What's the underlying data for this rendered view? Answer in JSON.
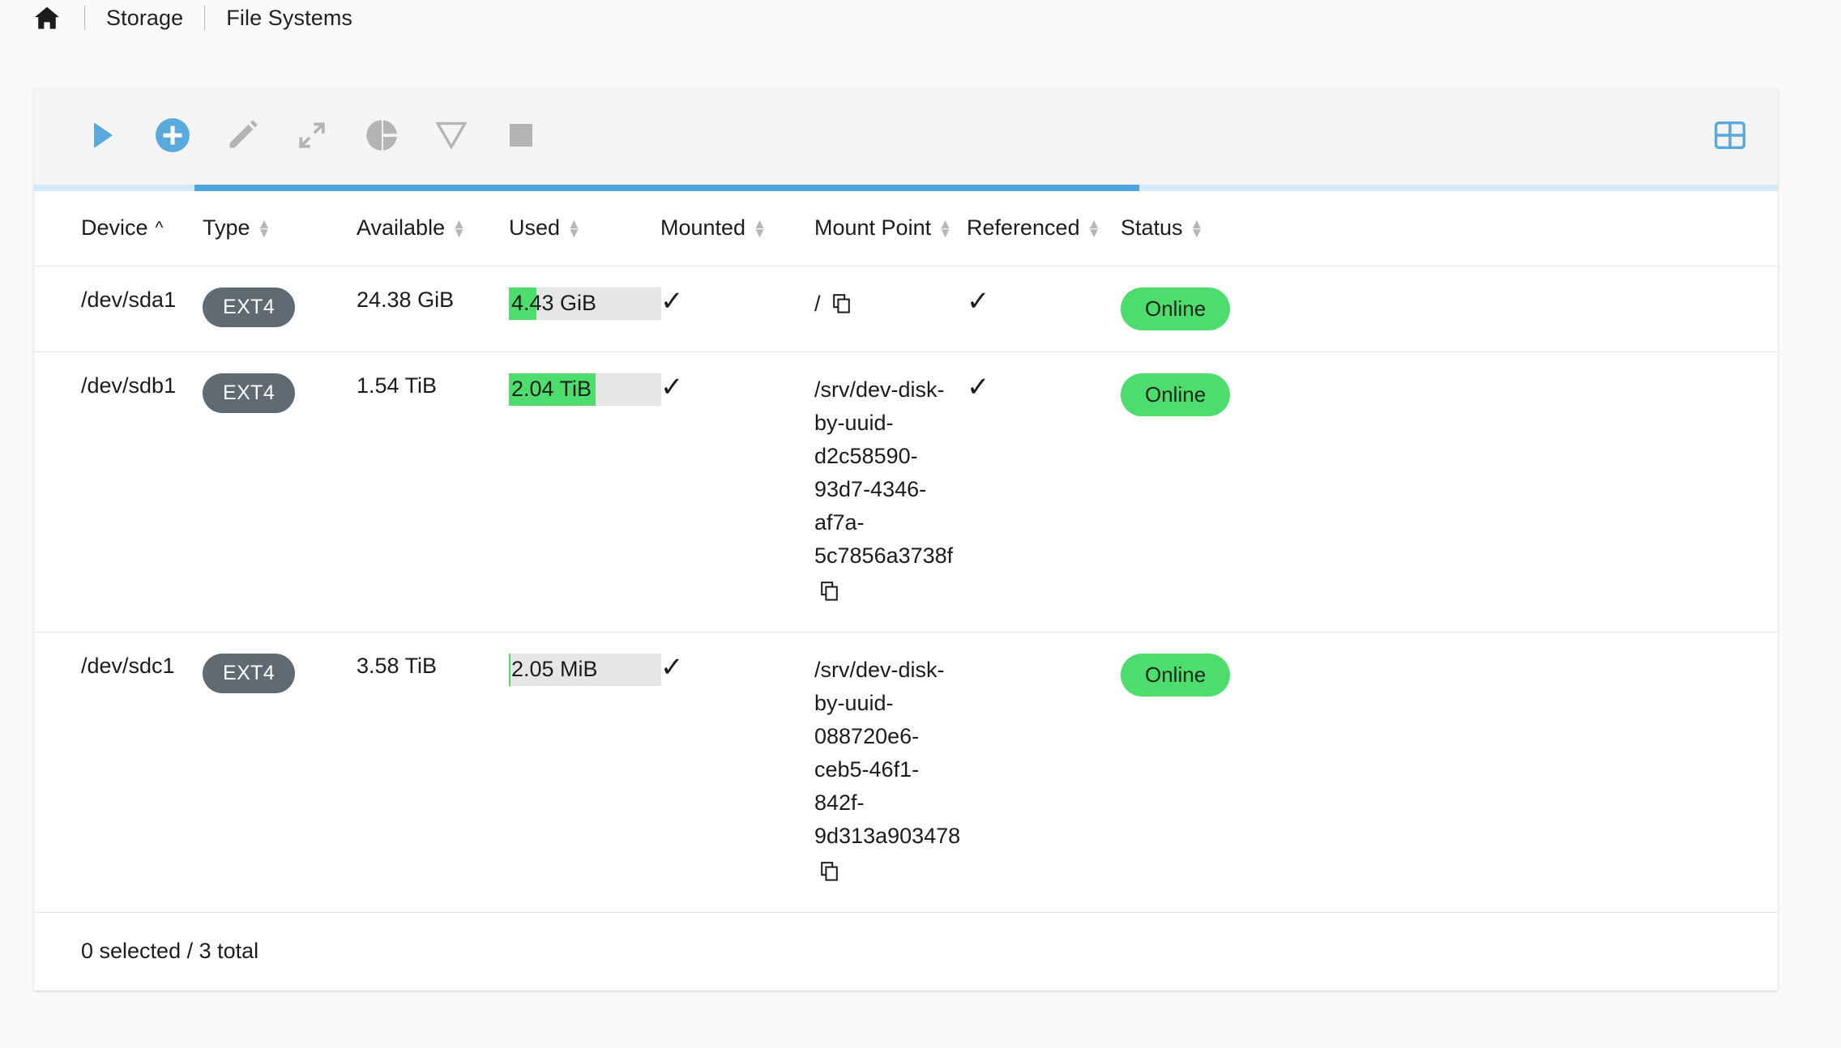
{
  "breadcrumb": {
    "home_icon": "home-icon",
    "items": [
      "Storage",
      "File Systems"
    ]
  },
  "toolbar": {
    "buttons": [
      {
        "name": "mount-button",
        "icon": "play-icon",
        "color": "#5aa9dd"
      },
      {
        "name": "create-button",
        "icon": "plus-circle-icon",
        "color": "#5aa9dd"
      },
      {
        "name": "edit-button",
        "icon": "pencil-icon",
        "color": "#b4b4b4"
      },
      {
        "name": "resize-button",
        "icon": "expand-arrows-icon",
        "color": "#b4b4b4"
      },
      {
        "name": "quota-button",
        "icon": "pie-chart-icon",
        "color": "#b4b4b4"
      },
      {
        "name": "unmount-button",
        "icon": "triangle-down-icon",
        "color": "#b4b4b4"
      },
      {
        "name": "stop-button",
        "icon": "stop-square-icon",
        "color": "#b4b4b4"
      }
    ],
    "grid_button": {
      "name": "column-settings-button",
      "icon": "grid-table-icon",
      "color": "#5aa9dd"
    }
  },
  "loading_bar": {
    "track_color": "#d6e8f5",
    "segment_color": "#4fa3da"
  },
  "table": {
    "columns": [
      {
        "label": "Device",
        "sort": "asc"
      },
      {
        "label": "Type",
        "sort": "none"
      },
      {
        "label": "Available",
        "sort": "none"
      },
      {
        "label": "Used",
        "sort": "none"
      },
      {
        "label": "Mounted",
        "sort": "none"
      },
      {
        "label": "Mount Point",
        "sort": "none"
      },
      {
        "label": "Referenced",
        "sort": "none"
      },
      {
        "label": "Status",
        "sort": "none"
      }
    ],
    "rows": [
      {
        "device": "/dev/sda1",
        "type": "EXT4",
        "available": "24.38 GiB",
        "used_label": "4.43 GiB",
        "used_percent": 18,
        "mounted": "✓",
        "mount_point": "/",
        "referenced": "✓",
        "status": "Online"
      },
      {
        "device": "/dev/sdb1",
        "type": "EXT4",
        "available": "1.54 TiB",
        "used_label": "2.04 TiB",
        "used_percent": 57,
        "mounted": "✓",
        "mount_point": "/srv/dev-disk-by-uuid-d2c58590-93d7-4346-af7a-5c7856a3738f",
        "referenced": "✓",
        "status": "Online"
      },
      {
        "device": "/dev/sdc1",
        "type": "EXT4",
        "available": "3.58 TiB",
        "used_label": "2.05 MiB",
        "used_percent": 1,
        "mounted": "✓",
        "mount_point": "/srv/dev-disk-by-uuid-088720e6-ceb5-46f1-842f-9d313a903478",
        "referenced": "",
        "status": "Online"
      }
    ],
    "footer": "0 selected / 3 total"
  },
  "colors": {
    "accent_blue": "#5aa9dd",
    "usage_green": "#4ddd6d",
    "status_green": "#4ddd6d",
    "type_badge_gray": "#606a72",
    "usage_track": "#e6e6e6"
  }
}
